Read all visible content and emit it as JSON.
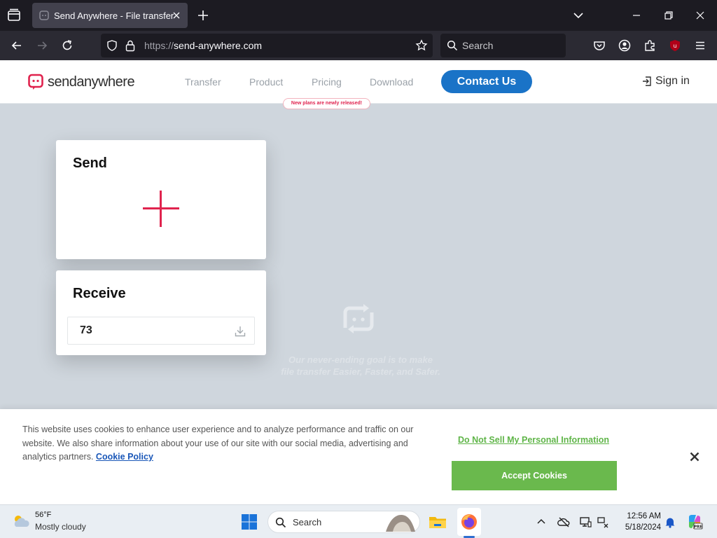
{
  "browser": {
    "tab_title": "Send Anywhere - File transfer",
    "url_scheme": "https://",
    "url_host": "send-anywhere.com",
    "search_placeholder": "Search",
    "extension_badge": "12"
  },
  "site": {
    "logo_text": "sendanywhere",
    "nav": [
      "Transfer",
      "Product",
      "Pricing",
      "Download"
    ],
    "pricing_tooltip": "New plans are newly released!",
    "contact_label": "Contact Us",
    "signin_label": "Sign in",
    "accent_color": "#e0234e",
    "brand_blue": "#1a73c7"
  },
  "main": {
    "send_title": "Send",
    "receive_title": "Receive",
    "receive_value": "73",
    "tagline_line1": "Our never-ending goal is to make",
    "tagline_line2": "file transfer Easier, Faster, and Safer."
  },
  "cookie": {
    "text": "This website uses cookies to enhance user experience and to analyze performance and traffic on our website. We also share information about your use of our site with our social media, advertising and analytics partners.",
    "policy_link": "Cookie Policy",
    "dns_link": "Do Not Sell My Personal Information",
    "accept_label": "Accept Cookies",
    "accept_color": "#6ab94d"
  },
  "taskbar": {
    "weather_temp": "56°F",
    "weather_desc": "Mostly cloudy",
    "search_label": "Search",
    "time": "12:56 AM",
    "date": "5/18/2024"
  }
}
